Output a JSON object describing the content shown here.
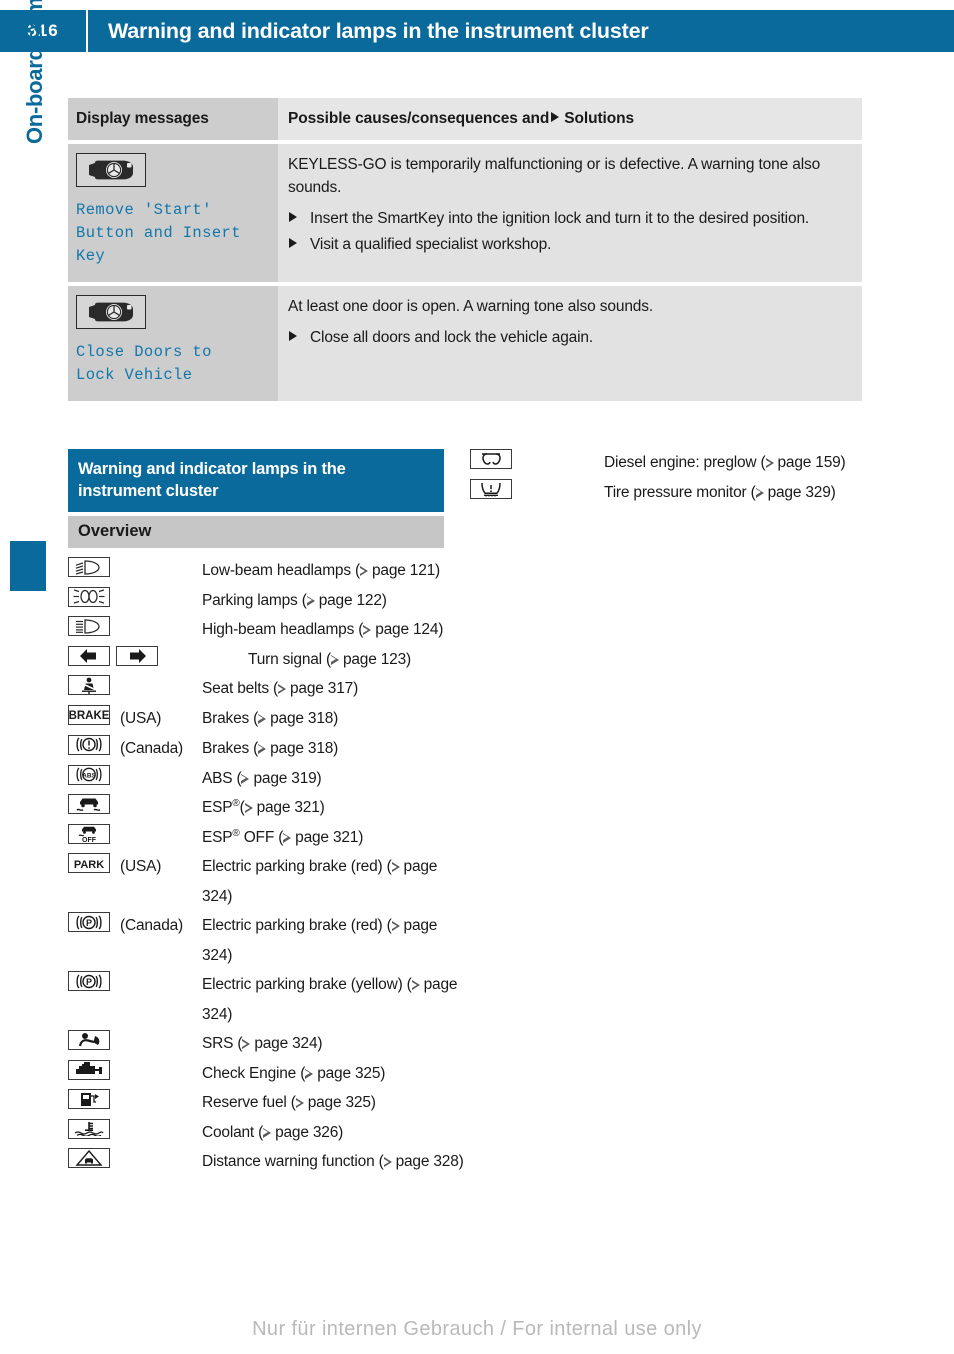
{
  "header": {
    "page_number": "316",
    "title": "Warning and indicator lamps in the instrument cluster",
    "accent_color": "#0a6a9c"
  },
  "sidebar": {
    "chapter_label": "On-board computer and displays"
  },
  "message_table": {
    "columns": {
      "display_messages": "Display messages",
      "solutions_prefix": "Possible causes/consequences and",
      "solutions_suffix": "Solutions"
    },
    "rows": [
      {
        "icon": "smartkey-icon",
        "message": "Remove 'Start'\nButton and Insert\nKey",
        "cause": "KEYLESS-GO is temporarily malfunctioning or is defective. A warning tone also sounds.",
        "solutions": [
          "Insert the SmartKey into the ignition lock and turn it to the desired position.",
          "Visit a qualified specialist workshop."
        ]
      },
      {
        "icon": "smartkey-icon",
        "message": "Close Doors to\nLock Vehicle",
        "cause": "At least one door is open. A warning tone also sounds.",
        "solutions": [
          "Close all doors and lock the vehicle again."
        ]
      }
    ]
  },
  "section": {
    "heading": "Warning and indicator lamps in the instrument cluster",
    "subheading": "Overview"
  },
  "overview_left": [
    {
      "icons": [
        "low-beam-headlamp-icon"
      ],
      "region": "",
      "desc": "Low-beam headlamps (▷ page 121)"
    },
    {
      "icons": [
        "parking-lamp-icon"
      ],
      "region": "",
      "desc": "Parking lamps (▷ page 122)"
    },
    {
      "icons": [
        "high-beam-headlamp-icon"
      ],
      "region": "",
      "desc": "High-beam headlamps (▷ page 124)"
    },
    {
      "icons": [
        "turn-signal-left-icon",
        "turn-signal-right-icon"
      ],
      "region": "",
      "desc": "Turn signal (▷ page 123)"
    },
    {
      "icons": [
        "seat-belt-icon"
      ],
      "region": "",
      "desc": "Seat belts (▷ page 317)"
    },
    {
      "icons": [
        "brake-usa-icon"
      ],
      "region": "(USA)",
      "desc": "Brakes (▷ page 318)"
    },
    {
      "icons": [
        "brake-canada-icon"
      ],
      "region": "(Canada)",
      "desc": "Brakes (▷ page 318)"
    },
    {
      "icons": [
        "abs-icon"
      ],
      "region": "",
      "desc": "ABS (▷ page 319)"
    },
    {
      "icons": [
        "esp-icon"
      ],
      "region": "",
      "desc": "ESP®(▷ page 321)"
    },
    {
      "icons": [
        "esp-off-icon"
      ],
      "region": "",
      "desc": "ESP® OFF (▷ page 321)"
    },
    {
      "icons": [
        "park-usa-icon"
      ],
      "region": "(USA)",
      "desc": "Electric parking brake (red) (▷ page 324)"
    },
    {
      "icons": [
        "park-canada-icon"
      ],
      "region": "(Canada)",
      "desc": "Electric parking brake (red) (▷ page 324)"
    },
    {
      "icons": [
        "park-yellow-icon"
      ],
      "region": "",
      "desc": "Electric parking brake (yellow) (▷ page 324)"
    },
    {
      "icons": [
        "srs-airbag-icon"
      ],
      "region": "",
      "desc": "SRS (▷ page 324)"
    },
    {
      "icons": [
        "check-engine-icon"
      ],
      "region": "",
      "desc": "Check Engine (▷ page 325)"
    },
    {
      "icons": [
        "reserve-fuel-icon"
      ],
      "region": "",
      "desc": "Reserve fuel (▷ page 325)"
    },
    {
      "icons": [
        "coolant-icon"
      ],
      "region": "",
      "desc": "Coolant (▷ page 326)"
    },
    {
      "icons": [
        "distance-warning-icon"
      ],
      "region": "",
      "desc": "Distance warning function (▷ page 328)"
    }
  ],
  "overview_right": [
    {
      "icons": [
        "preglow-icon"
      ],
      "region": "",
      "desc": "Diesel engine: preglow (▷ page 159)"
    },
    {
      "icons": [
        "tire-pressure-icon"
      ],
      "region": "",
      "desc": "Tire pressure monitor (▷ page 329)"
    }
  ],
  "footer": {
    "note": "Nur für internen Gebrauch / For internal use only"
  }
}
